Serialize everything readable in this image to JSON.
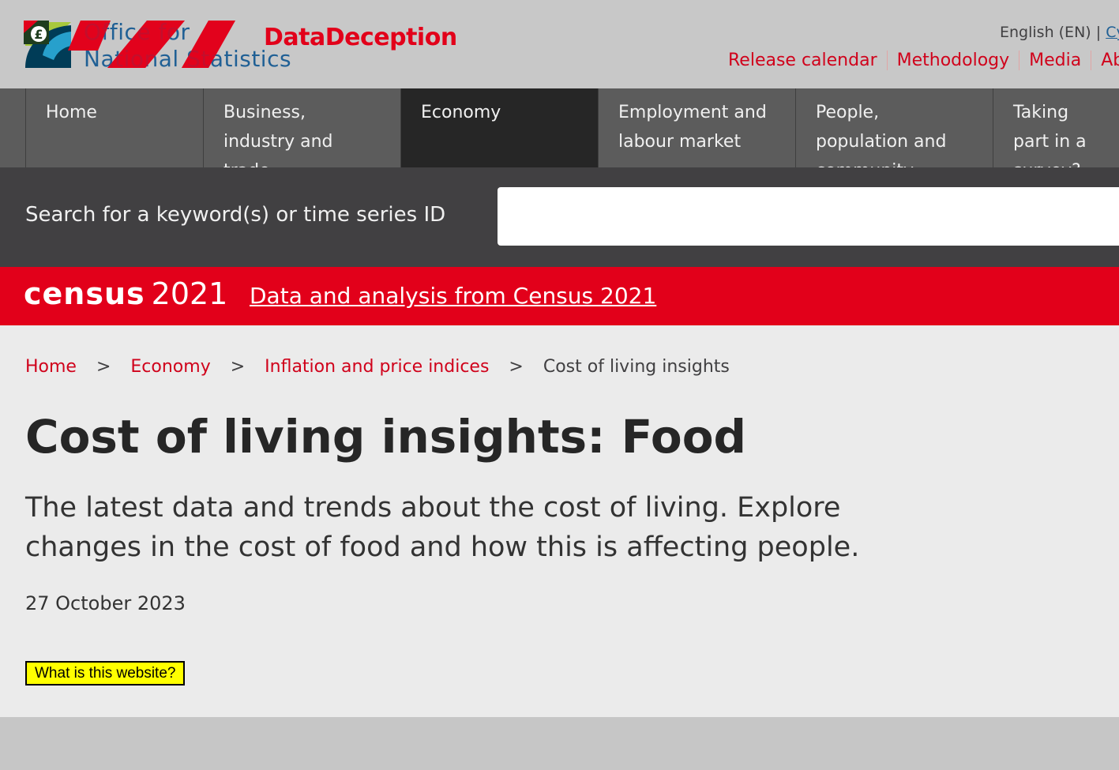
{
  "header": {
    "ons_logo_line1": "Office for",
    "ons_logo_line2": "National Statistics",
    "brand": "DataDeception",
    "brand_badge_symbol": "£",
    "language": "English (EN)",
    "language_sep": " | ",
    "language_alt": "Cymraeg",
    "links": [
      "Release calendar",
      "Methodology",
      "Media",
      "About"
    ]
  },
  "nav": {
    "items": [
      "Home",
      "Business, industry and trade",
      "Economy",
      "Employment and labour market",
      "People, population and community",
      "Taking part in a survey?"
    ],
    "active": "Economy"
  },
  "search": {
    "label": "Search for a keyword(s) or time series ID",
    "value": ""
  },
  "census": {
    "logo_word": "census",
    "logo_year": "2021",
    "link": "Data and analysis from Census 2021"
  },
  "breadcrumb": {
    "items": [
      "Home",
      "Economy",
      "Inflation and price indices"
    ],
    "current": "Cost of living insights",
    "separator": ">"
  },
  "page": {
    "title": "Cost of living insights: Food",
    "description": "The latest data and trends about the cost of living. Explore changes in the cost of food and how this is affecting people.",
    "date": "27 October 2023",
    "badge_button": "What is this website?"
  },
  "colors": {
    "accent_red": "#d0021b",
    "census_red": "#e2001a",
    "nav_bg": "#5c5c5c",
    "nav_active": "#262626",
    "badge_yellow": "#ffff00"
  }
}
